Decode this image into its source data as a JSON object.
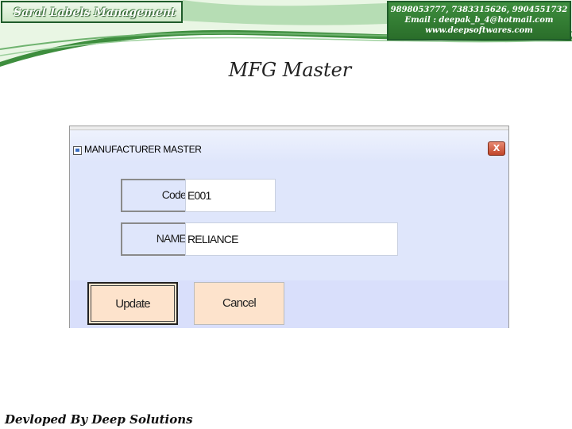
{
  "header": {
    "brand": "Saral Labels Management",
    "contact_phones": "9898053777, 7383315626, 9904551732",
    "contact_email": "Email : deepak_b_4@hotmail.com",
    "contact_web": "www.deepsoftwares.com"
  },
  "slide": {
    "title": "MFG Master",
    "footer": "Devloped By Deep Solutions"
  },
  "dialog": {
    "title": "MANUFACTURER MASTER",
    "close_glyph": "X",
    "fields": [
      {
        "label": "Code",
        "value": "E001"
      },
      {
        "label": "NAME",
        "value": "RELIANCE"
      }
    ],
    "update_label": "Update",
    "cancel_label": "Cancel"
  },
  "colors": {
    "band_green": "#3e8e3e",
    "dialog_bg": "#dfe6fb",
    "button_bg": "#fde3cc",
    "close_red": "#c0462a"
  },
  "icons": [
    "window-system-icon",
    "close-icon"
  ]
}
